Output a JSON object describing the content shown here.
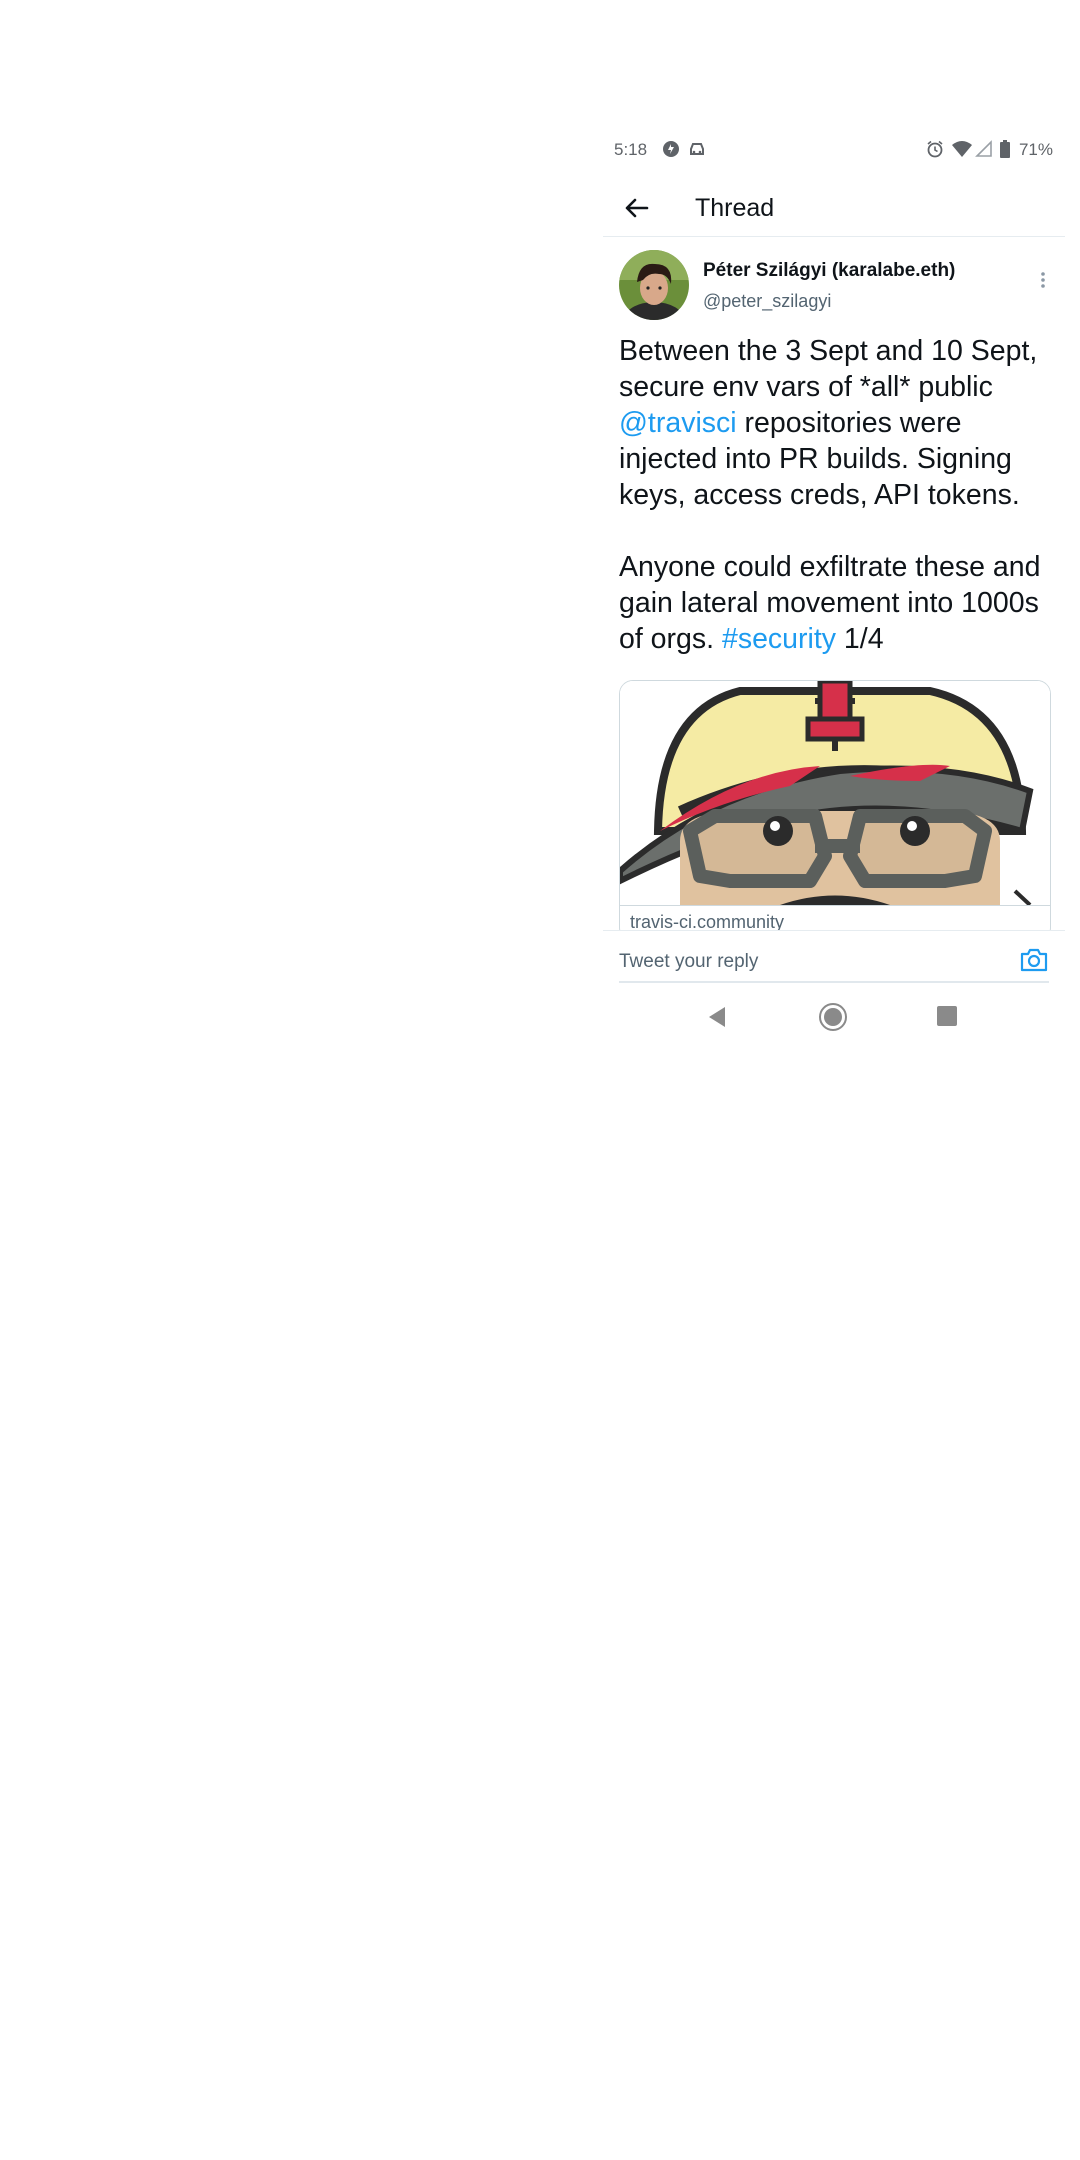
{
  "status_bar": {
    "time": "5:18",
    "battery_percent": "71%",
    "icons": [
      "data-saver-icon",
      "car-icon",
      "alarm-icon",
      "wifi-icon",
      "signal-icon",
      "battery-icon"
    ]
  },
  "app_bar": {
    "title": "Thread",
    "back_icon": "arrow-left-icon"
  },
  "tweet": {
    "author_name": "Péter Szilágyi (karalabe.eth)",
    "author_handle": "@peter_szilagyi",
    "para1_before": "Between the 3 Sept and 10 Sept, secure env vars of *all* public ",
    "mention": "@travisci",
    "para1_after": " repositories were injected into PR builds. Signing keys, access creds, API tokens.",
    "para2_before": "Anyone could exfiltrate these and gain lateral movement into 1000s of orgs. ",
    "hashtag": "#security",
    "para2_after": " 1/4",
    "card_domain": "travis-ci.community",
    "more_icon": "more-vertical-icon"
  },
  "reply": {
    "placeholder": "Tweet your reply",
    "camera_icon": "camera-icon"
  },
  "nav": {
    "icons": [
      "back-triangle-icon",
      "home-circle-icon",
      "recents-square-icon"
    ]
  },
  "colors": {
    "link": "#1d9bf0",
    "text": "#0f1419",
    "secondary": "#536471"
  }
}
